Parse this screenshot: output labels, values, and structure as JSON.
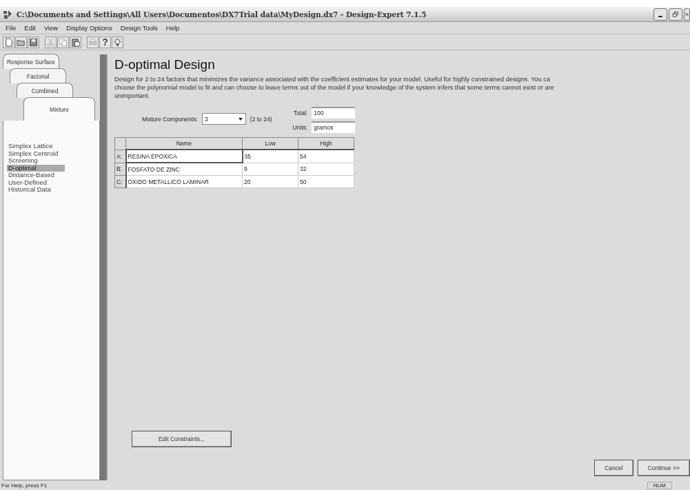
{
  "window": {
    "title": "C:\\Documents and Settings\\All Users\\Documentos\\DX7Trial data\\MyDesign.dx7 - Design-Expert 7.1.5"
  },
  "menu": [
    "File",
    "Edit",
    "View",
    "Display Options",
    "Design Tools",
    "Help"
  ],
  "toolbar": [
    {
      "kind": "new",
      "disabled": false
    },
    {
      "kind": "open",
      "disabled": false
    },
    {
      "kind": "save",
      "disabled": false
    },
    {
      "kind": "cut",
      "disabled": true
    },
    {
      "kind": "copy",
      "disabled": true
    },
    {
      "kind": "paste",
      "disabled": false
    },
    {
      "kind": "print",
      "disabled": true
    },
    {
      "kind": "text",
      "label": "?",
      "disabled": false
    },
    {
      "kind": "tip",
      "disabled": false
    }
  ],
  "tabs": [
    {
      "label": "Response Surface",
      "selected": false
    },
    {
      "label": "Factorial",
      "selected": false
    },
    {
      "label": "Combined",
      "selected": false
    },
    {
      "label": "Mixture",
      "selected": true
    }
  ],
  "design_list": [
    {
      "label": "Simplex Lattice",
      "selected": false
    },
    {
      "label": "Simplex Centroid",
      "selected": false
    },
    {
      "label": "Screening",
      "selected": false
    },
    {
      "label": "D-optimal",
      "selected": true
    },
    {
      "label": "Distance-Based",
      "selected": false
    },
    {
      "label": "User-Defined",
      "selected": false
    },
    {
      "label": "Historical Data",
      "selected": false
    }
  ],
  "heading": "D-optimal Design",
  "description": [
    "Design for 2 to 24 factors that minimizes the variance associated with the coefficient estimates for your model.  Useful for highly constrained designs.  You ca",
    "choose the polynomial model to fit and can choose to leave terms out of the model if your knowledge of the system infers that some terms cannot exist or are",
    "unimportant."
  ],
  "components": {
    "label": "Mixture Components:",
    "value": "3",
    "range": "(2 to 24)"
  },
  "total": {
    "label": "Total:",
    "value": "100"
  },
  "units": {
    "label": "Units:",
    "value": "gramos"
  },
  "table": {
    "columns": [
      "Name",
      "Low",
      "High"
    ],
    "rows": [
      {
        "id": "A:",
        "name": "RESINA EPOXICA",
        "low": "35",
        "high": "54",
        "selected": true
      },
      {
        "id": "B:",
        "name": "FOSFATO DE ZINC",
        "low": "9",
        "high": "32",
        "selected": false
      },
      {
        "id": "C:",
        "name": "OXIDO METALLICO LAMINAR",
        "low": "20",
        "high": "50",
        "selected": false
      }
    ]
  },
  "buttons": {
    "edit": "Edit Constraints...",
    "cancel": "Cancel",
    "continue": "Continue >>"
  },
  "status_bar": {
    "text": "For Help, press F1",
    "indicator": "NUM"
  }
}
